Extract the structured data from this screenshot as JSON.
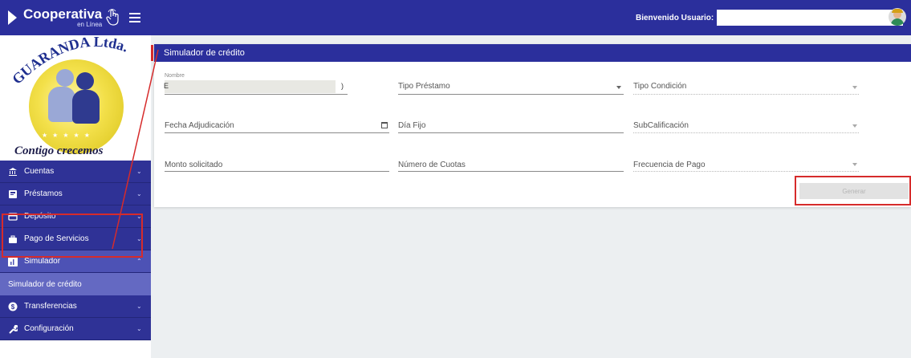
{
  "header": {
    "brand": "Cooperativa",
    "brand_sub": "en Línea",
    "welcome_label": "Bienvenido Usuario:"
  },
  "logo": {
    "arc_text": "GUARANDA Ltda.",
    "tagline": "Contigo crecemos"
  },
  "sidebar": {
    "items": [
      {
        "label": "Cuentas",
        "icon": "bank-icon"
      },
      {
        "label": "Préstamos",
        "icon": "document-icon"
      },
      {
        "label": "Depósito",
        "icon": "card-icon"
      },
      {
        "label": "Pago de Servicios",
        "icon": "briefcase-icon"
      },
      {
        "label": "Simulador",
        "icon": "chart-icon"
      },
      {
        "label": "Transferencias",
        "icon": "dollar-icon"
      },
      {
        "label": "Configuración",
        "icon": "wrench-icon"
      }
    ],
    "submenu": {
      "label": "Simulador de crédito"
    }
  },
  "form": {
    "title": "Simulador de crédito",
    "nombre_label": "Nombre",
    "tipo_prestamo": "Tipo Préstamo",
    "tipo_condicion": "Tipo Condición",
    "fecha_adjudicacion": "Fecha Adjudicación",
    "dia_fijo": "Día Fijo",
    "subcalificacion": "SubCalificación",
    "monto_solicitado": "Monto solicitado",
    "numero_cuotas": "Número de Cuotas",
    "frecuencia_pago": "Frecuencia de Pago",
    "generar": "Generar"
  },
  "colors": {
    "primary": "#2b2f9c",
    "highlight": "#d62b2b",
    "submenu": "#6469c2"
  }
}
